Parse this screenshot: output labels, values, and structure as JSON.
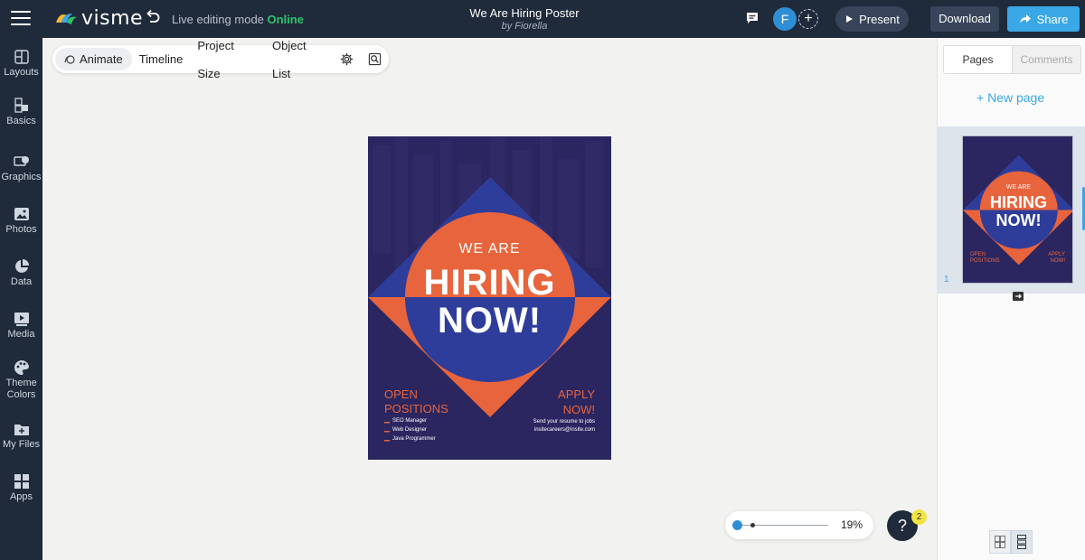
{
  "header": {
    "logo_text": "visme",
    "edit_mode_label": "Live editing mode",
    "edit_mode_status": "Online",
    "doc_title": "We Are Hiring Poster",
    "doc_author": "by Fiorella",
    "avatar_initial": "F",
    "present_label": "Present",
    "download_label": "Download",
    "share_label": "Share"
  },
  "sidebar": {
    "items": [
      {
        "label": "Layouts",
        "icon": "layouts-icon"
      },
      {
        "label": "Basics",
        "icon": "basics-icon"
      },
      {
        "label": "Graphics",
        "icon": "graphics-icon"
      },
      {
        "label": "Photos",
        "icon": "photos-icon"
      },
      {
        "label": "Data",
        "icon": "data-icon"
      },
      {
        "label": "Media",
        "icon": "media-icon"
      },
      {
        "label": "Theme Colors",
        "icon": "palette-icon"
      },
      {
        "label": "My Files",
        "icon": "folder-icon"
      },
      {
        "label": "Apps",
        "icon": "apps-icon"
      }
    ]
  },
  "toolbar": {
    "animate": "Animate",
    "timeline": "Timeline",
    "project_size": "Project Size",
    "object_list": "Object List"
  },
  "poster": {
    "we_are": "WE ARE",
    "hiring": "HIRING",
    "now": "NOW!",
    "open_1": "OPEN",
    "open_2": "POSITIONS",
    "positions": [
      "SEO Manager",
      "Web Designer",
      "Java Programmer"
    ],
    "apply_1": "APPLY",
    "apply_2": "NOW!",
    "send_text": "Send your resume to jobs",
    "email": "insitecareers@insite.com",
    "colors": {
      "navy": "#2b2660",
      "orange": "#e8643c",
      "blue": "#2e3d9a"
    }
  },
  "right_panel": {
    "tab_pages": "Pages",
    "tab_comments": "Comments",
    "new_page": "+ New page",
    "page_number": "1"
  },
  "zoom": {
    "value": "19%"
  },
  "help": {
    "label": "?",
    "badge": "2"
  }
}
